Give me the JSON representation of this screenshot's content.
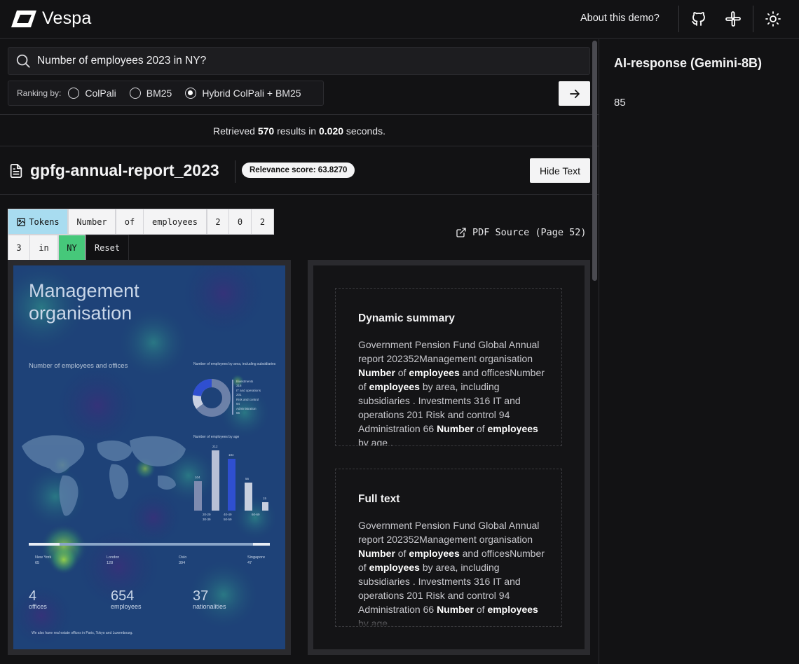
{
  "header": {
    "logo_text": "Vespa",
    "about_link": "About this demo?",
    "icons": [
      "github-icon",
      "slack-icon",
      "sun-icon"
    ]
  },
  "search": {
    "query": "Number of employees 2023 in NY?",
    "ranking_label": "Ranking by:",
    "ranking_options": [
      "ColPali",
      "BM25",
      "Hybrid ColPali + BM25"
    ],
    "selected_ranking": "Hybrid ColPali + BM25"
  },
  "results": {
    "retrieved_prefix": "Retrieved ",
    "count": "570",
    "middle": " results in ",
    "time": "0.020",
    "suffix": " seconds."
  },
  "result": {
    "title": "gpfg-annual-report_2023",
    "relevance": "Relevance score: 63.8270",
    "hide_text_button": "Hide Text",
    "tokens_label": "Tokens",
    "tokens": [
      "Number",
      "of",
      "employees",
      "2",
      "0",
      "2",
      "3",
      "in",
      "NY"
    ],
    "highlighted_token": "NY",
    "reset_label": "Reset",
    "pdf_source": "PDF Source (Page 52)",
    "page_image": {
      "heading_line1": "Management",
      "heading_line2": "organisation",
      "subheading": "Number of employees and offices",
      "by_area_title": "Number of employees by area, including subsidiaries",
      "area_legend": [
        {
          "label": "Investments",
          "value": "316"
        },
        {
          "label": "IT and operations",
          "value": "201"
        },
        {
          "label": "Risk and control",
          "value": "94"
        },
        {
          "label": "Administration",
          "value": "66"
        }
      ],
      "by_age_title": "Number of employees by age",
      "age_bars": [
        {
          "label": "20-29",
          "value": "104"
        },
        {
          "label": "30-39",
          "value": "212"
        },
        {
          "label": "40-49",
          "value": "184"
        },
        {
          "label": "50-59",
          "value": "56"
        },
        {
          "label": "60-69",
          "value": "15"
        }
      ],
      "age_legend": [
        "20-29",
        "30-39",
        "40-49",
        "50-59",
        "60-69"
      ],
      "offices": [
        {
          "city": "New York",
          "count": "65"
        },
        {
          "city": "London",
          "count": "128"
        },
        {
          "city": "Oslo",
          "count": "394"
        },
        {
          "city": "Singapore",
          "count": "47"
        }
      ],
      "stats": [
        {
          "num": "4",
          "label": "offices"
        },
        {
          "num": "654",
          "label": "employees"
        },
        {
          "num": "37",
          "label": "nationalities"
        }
      ],
      "footnote": "We also have real estate offices in Paris, Tokyo and Luxembourg."
    },
    "dynamic_summary": {
      "heading": "Dynamic summary",
      "segments": [
        {
          "t": "Government Pension Fund Global Annual report 202352Management organisation ",
          "b": false
        },
        {
          "t": "Number",
          "b": true
        },
        {
          "t": " of ",
          "b": false
        },
        {
          "t": "employees",
          "b": true
        },
        {
          "t": " and officesNumber of ",
          "b": false
        },
        {
          "t": "employees",
          "b": true
        },
        {
          "t": " by area, including subsidiaries . Investments 316 IT and operations 201 Risk and control 94 Administration 66 ",
          "b": false
        },
        {
          "t": "Number",
          "b": true
        },
        {
          "t": " of ",
          "b": false
        },
        {
          "t": "employees",
          "b": true
        },
        {
          "t": " by age .",
          "b": false
        }
      ]
    },
    "full_text": {
      "heading": "Full text",
      "segments": [
        {
          "t": "Government Pension Fund Global Annual report 202352Management organisation ",
          "b": false
        },
        {
          "t": "Number",
          "b": true
        },
        {
          "t": " of ",
          "b": false
        },
        {
          "t": "employees",
          "b": true
        },
        {
          "t": " and officesNumber of ",
          "b": false
        },
        {
          "t": "employees",
          "b": true
        },
        {
          "t": " by area, including subsidiaries . Investments 316 IT and operations 201 Risk and control 94 Administration 66 ",
          "b": false
        },
        {
          "t": "Number",
          "b": true
        },
        {
          "t": " of ",
          "b": false
        },
        {
          "t": "employees",
          "b": true
        },
        {
          "t": " by age .",
          "b": false
        }
      ]
    }
  },
  "ai": {
    "title": "AI-response (Gemini-8B)",
    "answer": "85"
  },
  "colors": {
    "background": "#121214",
    "tokens_tab": "#a8dcf0",
    "highlight_token": "#46c87a",
    "heatmap_base": "#1b3a73",
    "heatmap_hot": "#b7d334"
  }
}
